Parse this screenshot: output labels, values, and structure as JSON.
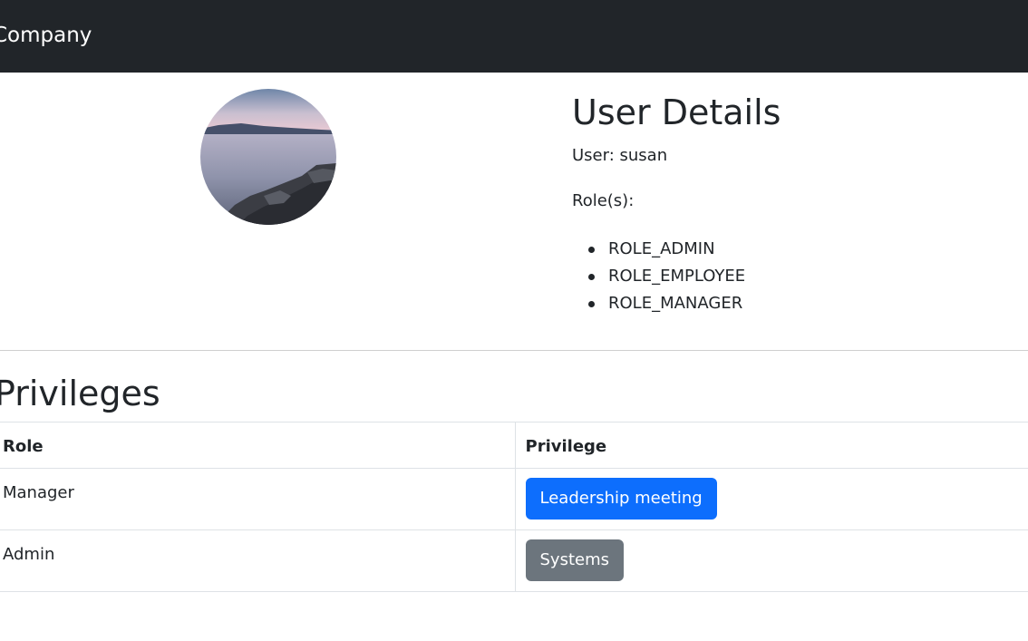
{
  "navbar": {
    "brand": "Company"
  },
  "user_details": {
    "heading": "User Details",
    "user_line": "User: susan",
    "roles_label": "Role(s):",
    "roles": [
      "ROLE_ADMIN",
      "ROLE_EMPLOYEE",
      "ROLE_MANAGER"
    ]
  },
  "privileges": {
    "heading": "Privileges",
    "columns": [
      "Role",
      "Privilege"
    ],
    "rows": [
      {
        "role": "Manager",
        "privilege": "Leadership meeting",
        "button_color": "#0d6efd"
      },
      {
        "role": "Admin",
        "privilege": "Systems",
        "button_color": "#6c757d"
      }
    ]
  },
  "colors": {
    "navbar_bg": "#212529",
    "primary": "#0d6efd",
    "secondary": "#6c757d"
  }
}
